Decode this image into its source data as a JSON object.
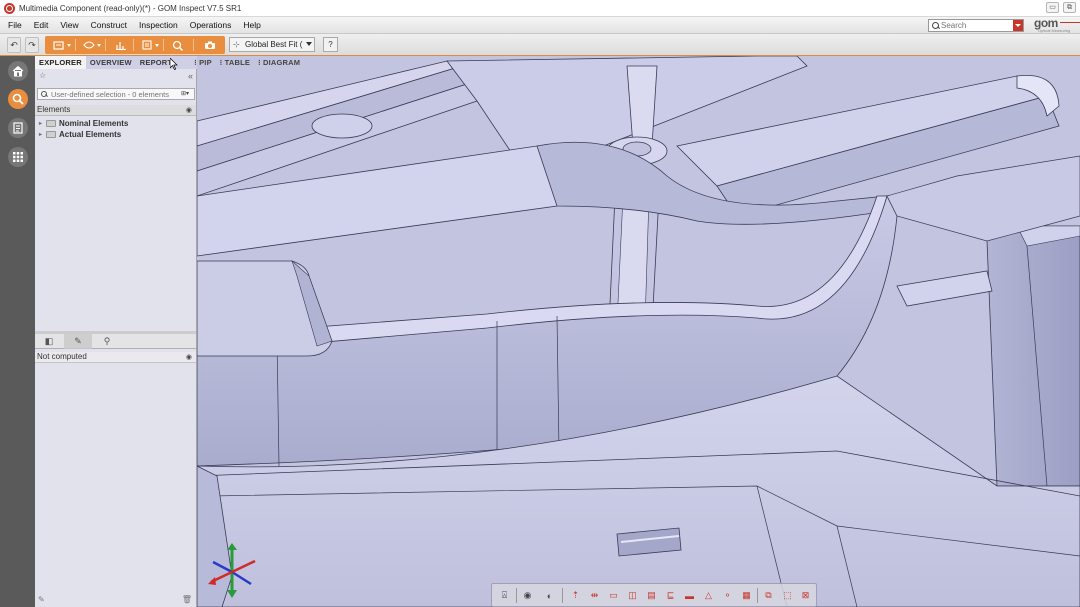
{
  "window": {
    "title": "Multimedia Component (read-only)(*) - GOM Inspect V7.5 SR1",
    "buttons": [
      "▭",
      "⧉"
    ]
  },
  "menu": {
    "items": [
      "File",
      "Edit",
      "View",
      "Construct",
      "Inspection",
      "Operations",
      "Help"
    ],
    "search_placeholder": "Search",
    "logo_text": "gom",
    "logo_subtext": "Optical Measuring"
  },
  "toolbar": {
    "alignment_label": "Global Best Fit (",
    "help_label": "?"
  },
  "tabs": {
    "explorer": "EXPLORER",
    "overview": "OVERVIEW",
    "report": "REPORT",
    "pip": "PIP",
    "table": "TABLE",
    "diagram": "DIAGRAM"
  },
  "explorer": {
    "selection_placeholder": "User-defined selection - 0 elements",
    "elements_header": "Elements",
    "tree": [
      {
        "label": "Nominal Elements"
      },
      {
        "label": "Actual Elements"
      }
    ]
  },
  "properties": {
    "status": "Not computed"
  },
  "colors": {
    "accent_orange": "#e98e3f",
    "brand_red": "#c8352a",
    "viewport_bg": "#c6c7e1",
    "navbar_bg": "#5a5a5a"
  },
  "icons": {
    "nav": [
      "home-icon",
      "inspect-icon",
      "report-icon",
      "apps-icon"
    ],
    "bottom_toolbar": [
      "selection-icon",
      "view-icon",
      "section-icon",
      "align-icon",
      "distance-icon",
      "box-icon",
      "plane-icon",
      "grid-icon",
      "layers-icon",
      "rect-icon",
      "triangle-icon",
      "shapes-icon",
      "pattern-icon",
      "copy-icon",
      "mark-icon",
      "reset-icon"
    ]
  }
}
